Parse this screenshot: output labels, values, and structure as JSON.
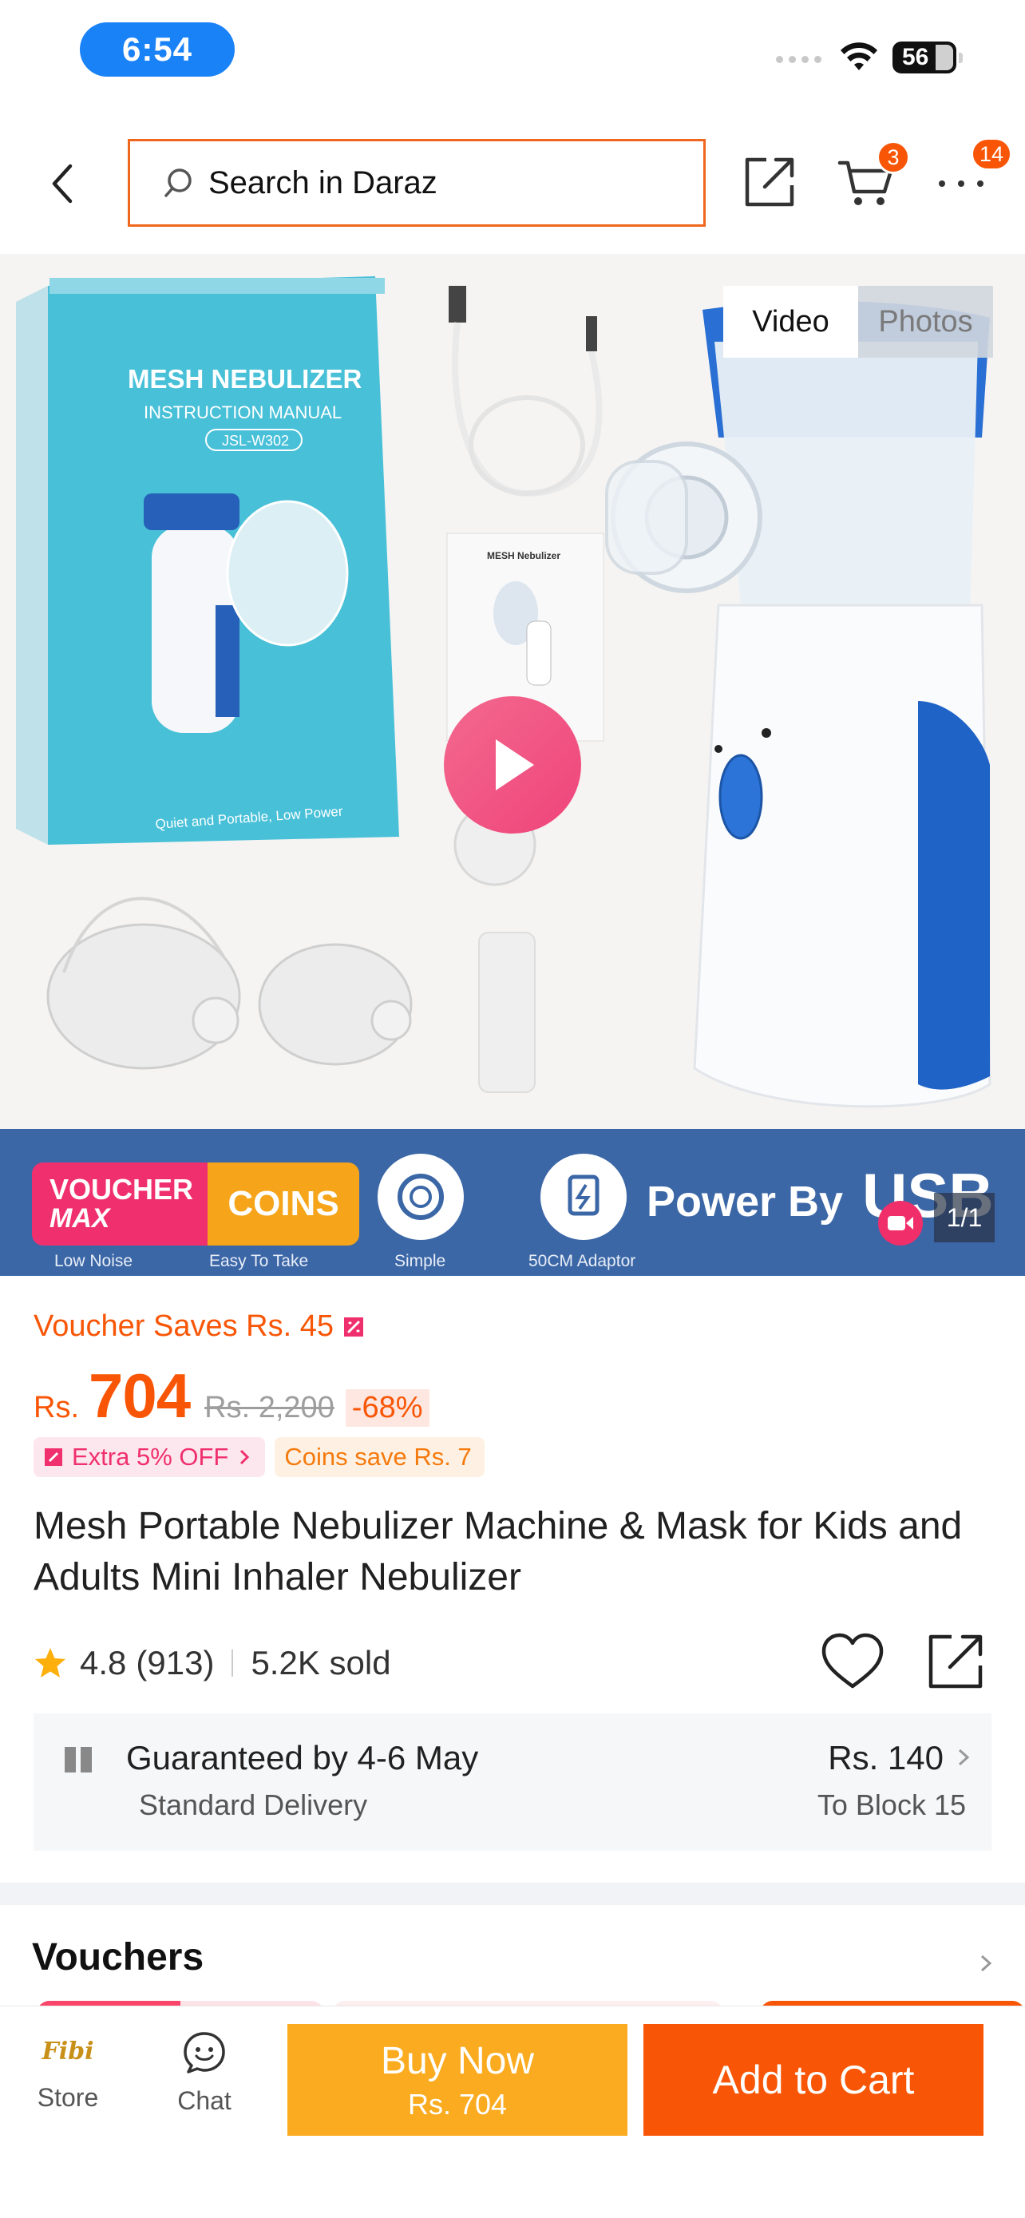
{
  "status_bar": {
    "time": "6:54",
    "battery": "56"
  },
  "header": {
    "search_placeholder": "Search in Daraz",
    "cart_count": "3",
    "more_count": "14"
  },
  "gallery": {
    "tabs": {
      "video": "Video",
      "photos": "Photos"
    },
    "page_indicator": "1/1",
    "box_title": "MESH NEBULIZER",
    "box_subtitle": "INSTRUCTION MANUAL",
    "box_model": "JSL-W302",
    "box_tagline": "Quiet and Portable, Low Power",
    "manual_title": "MESH Nebulizer",
    "usp_captions": [
      "Low Noise",
      "Easy To Take",
      "Simple",
      "50CM Adaptor"
    ],
    "power_text": "Power By",
    "usb_text": "USB",
    "badge_voucher": "VOUCHER",
    "badge_max": "MAX",
    "badge_coins": "COINS"
  },
  "price": {
    "voucher_saves": "Voucher Saves Rs. 45",
    "currency": "Rs.",
    "amount": "704",
    "original": "Rs. 2,200",
    "discount": "-68%",
    "extra_off": "Extra 5% OFF",
    "coins_save": "Coins save Rs. 7"
  },
  "product": {
    "title": "Mesh Portable Nebulizer Machine & Mask for Kids and Adults Mini Inhaler Nebulizer",
    "rating": "4.8",
    "reviews": "(913)",
    "sold": "5.2K sold"
  },
  "delivery": {
    "guarantee": "Guaranteed by 4-6 May",
    "type": "Standard Delivery",
    "fee": "Rs. 140",
    "destination": "To Block 15"
  },
  "vouchers": {
    "title": "Vouchers"
  },
  "bottom_bar": {
    "store_label": "Store",
    "store_logo": "Fibi",
    "chat_label": "Chat",
    "buy_now": "Buy Now",
    "buy_now_price": "Rs. 704",
    "add_to_cart": "Add to Cart"
  },
  "colors": {
    "brand": "#f85606",
    "buy_now": "#fbab1f",
    "time_pill": "#1a82f7",
    "usp_strip": "#3c67a6"
  }
}
